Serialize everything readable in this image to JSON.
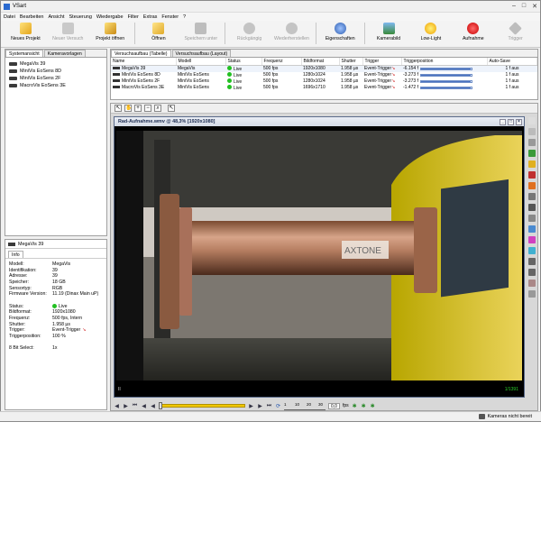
{
  "window": {
    "title": "VSart"
  },
  "menu": [
    "Datei",
    "Bearbeiten",
    "Ansicht",
    "Steuerung",
    "Wiedergabe",
    "Filter",
    "Extras",
    "Fenster",
    "?"
  ],
  "toolbar": [
    {
      "label": "Neues Projekt",
      "icon": "new-project-icon",
      "enabled": true
    },
    {
      "label": "Neuer Versuch",
      "icon": "new-trial-icon",
      "enabled": false
    },
    {
      "label": "Projekt öffnen",
      "icon": "open-project-icon",
      "enabled": true
    },
    {
      "label": "Öffnen",
      "icon": "open-folder-icon",
      "enabled": true
    },
    {
      "label": "Speichern unter",
      "icon": "save-as-icon",
      "enabled": false
    },
    {
      "label": "Rückgängig",
      "icon": "undo-icon",
      "enabled": false
    },
    {
      "label": "Wiederherstellen",
      "icon": "redo-icon",
      "enabled": false
    },
    {
      "label": "Eigenschaften",
      "icon": "properties-icon",
      "enabled": true
    },
    {
      "label": "Kamerabild",
      "icon": "camera-image-icon",
      "enabled": true
    },
    {
      "label": "Low-Light",
      "icon": "low-light-icon",
      "enabled": true
    },
    {
      "label": "Aufnahme",
      "icon": "record-icon",
      "enabled": true
    },
    {
      "label": "Trigger",
      "icon": "trigger-icon",
      "enabled": false
    }
  ],
  "left": {
    "tabs": [
      "Systemansicht",
      "Kameravorlagen"
    ],
    "tree": [
      "MegaVis 39",
      "MiniVis EoSens 8D",
      "MiniVis EoSens 2F",
      "MacroVis EoSens 3E"
    ]
  },
  "info": {
    "header": "MegaVis 39",
    "tab": "Info",
    "rows": [
      {
        "k": "Modell:",
        "v": "MegaVis"
      },
      {
        "k": "Identifikation:",
        "v": "39"
      },
      {
        "k": "Adresse:",
        "v": "39"
      },
      {
        "k": "Speicher:",
        "v": "18 GB"
      },
      {
        "k": "Sensortyp:",
        "v": "RGB"
      },
      {
        "k": "Firmware Version:",
        "v": "11.19 (Dinax Main uP)"
      }
    ],
    "rows2": [
      {
        "k": "Status:",
        "v": "Live"
      },
      {
        "k": "Bildformat:",
        "v": "1920x1080"
      },
      {
        "k": "Frequenz:",
        "v": "500 fps, Intern"
      },
      {
        "k": "Shutter:",
        "v": "1.958 µs"
      },
      {
        "k": "Trigger:",
        "v": "Event-Trigger"
      },
      {
        "k": "Triggerposition:",
        "v": "100 %"
      }
    ],
    "bitselect": {
      "k": "8 Bit Select:",
      "v": "1x"
    }
  },
  "right": {
    "tabs": [
      "Versuchsaufbau (Tabelle)",
      "Versuchsaufbau (Layout)"
    ],
    "columns": [
      "Name",
      "Modell",
      "Status",
      "Frequenz",
      "Bildformat",
      "Shutter",
      "Trigger",
      "Triggerposition",
      "Auto-Save"
    ],
    "rows": [
      {
        "name": "MegaVis 39",
        "modell": "MegaVis",
        "status": "Live",
        "freq": "500 fps",
        "format": "1920x1080",
        "shutter": "1.958 µs",
        "trigger": "Event-Trigger",
        "pos": "-6.154 f",
        "pos_frac": 0.98,
        "autosave": "1 f aus"
      },
      {
        "name": "MiniVis EoSens 8D",
        "modell": "MiniVis EoSens",
        "status": "Live",
        "freq": "500 fps",
        "format": "1280x1024",
        "shutter": "1.958 µs",
        "trigger": "Event-Trigger",
        "pos": "-3.273 f",
        "pos_frac": 0.98,
        "autosave": "1 f aus"
      },
      {
        "name": "MiniVis EoSens 2F",
        "modell": "MiniVis EoSens",
        "status": "Live",
        "freq": "500 fps",
        "format": "1280x1024",
        "shutter": "1.958 µs",
        "trigger": "Event-Trigger",
        "pos": "-3.273 f",
        "pos_frac": 0.98,
        "autosave": "1 f aus"
      },
      {
        "name": "MacroVis EoSens 3E",
        "modell": "MiniVis EoSens",
        "status": "Live",
        "freq": "500 fps",
        "format": "1696x1710",
        "shutter": "1.958 µs",
        "trigger": "Event-Trigger",
        "pos": "-1.472 f",
        "pos_frac": 0.98,
        "autosave": "1 f aus"
      }
    ]
  },
  "image": {
    "title": "Rad-Aufnahme.wmv @ 48,3% [1920x1080]",
    "frame": "1/1391",
    "paused": "II",
    "logo": "AXTONE"
  },
  "playback": {
    "fps_value": "0,0",
    "fps_unit": "fps",
    "scale": [
      "1",
      "10",
      "20",
      "30"
    ]
  },
  "status": {
    "text": "Kameras nicht bereit"
  },
  "colors": {
    "live": "#22c022",
    "seek": "#f0c800",
    "accent": "#4a72c0"
  }
}
